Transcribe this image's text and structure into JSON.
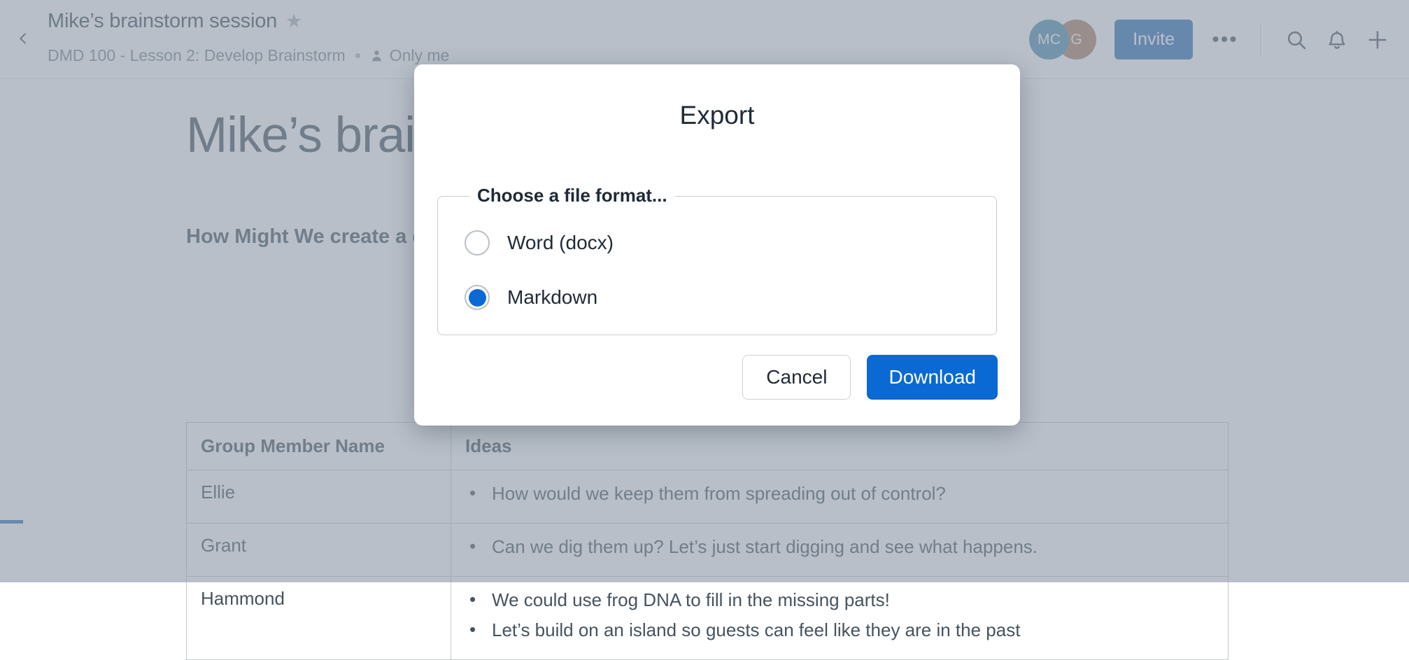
{
  "header": {
    "back_icon": "chevron-left-icon",
    "doc_title": "Mike’s brainstorm session",
    "star_icon": "★",
    "breadcrumb": "DMD 100 - Lesson 2: Develop Brainstorm",
    "privacy_label": "Only me",
    "person_icon": "person-icon",
    "avatars": [
      {
        "initials": "MC",
        "color": "#4e8fb2"
      },
      {
        "initials": "G",
        "color": "#b07e62"
      }
    ],
    "invite_label": "Invite",
    "more_label": "•••",
    "search_icon": "search-icon",
    "bell_icon": "bell-icon",
    "plus_icon": "plus-icon"
  },
  "document": {
    "page_title": "Mike’s brainstorm session",
    "hmw_heading": "How Might We create a dinosaur theme park?",
    "table": {
      "columns": [
        "Group Member Name",
        "Ideas"
      ],
      "rows": [
        {
          "name": "Ellie",
          "ideas": [
            "How would we keep them from spreading out of control?"
          ]
        },
        {
          "name": "Grant",
          "ideas": [
            "Can we dig them up? Let’s just start digging and see what happens."
          ]
        },
        {
          "name": "Hammond",
          "ideas": [
            "We could use frog DNA to fill in the missing parts!",
            "Let’s build on an island so guests can feel like they are in the past"
          ]
        }
      ]
    }
  },
  "modal": {
    "title": "Export",
    "fieldset_legend": "Choose a file format...",
    "options": [
      {
        "label": "Word (docx)",
        "selected": false
      },
      {
        "label": "Markdown",
        "selected": true
      }
    ],
    "cancel_label": "Cancel",
    "download_label": "Download"
  },
  "colors": {
    "accent_blue": "#0b69d4",
    "invite_blue": "#2c6fb8",
    "text_dark": "#1f2a37",
    "text_muted": "#7b8794",
    "left_accent": "#2f74b5"
  }
}
